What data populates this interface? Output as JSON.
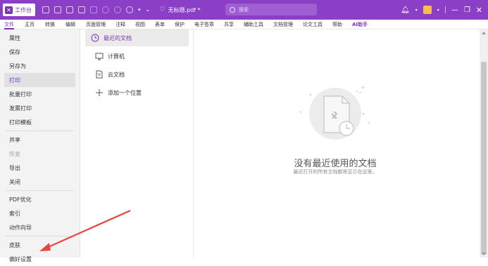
{
  "titlebar": {
    "workbench_label": "工作台",
    "doc_title": "无标题.pdf *",
    "search_placeholder": "搜索"
  },
  "menubar": {
    "items": [
      "文件",
      "主页",
      "转换",
      "编辑",
      "页面管理",
      "注释",
      "视图",
      "表单",
      "保护",
      "电子签章",
      "共享",
      "辅助工具",
      "文档管理",
      "论文工具",
      "帮助",
      "AI助手"
    ],
    "active_index": 0
  },
  "leftnav": {
    "items": [
      "属性",
      "保存",
      "另存为",
      "打印",
      "批量打印",
      "发票打印",
      "打印模板",
      "共享",
      "恢复",
      "导出",
      "关闭",
      "PDF优化",
      "索引",
      "动作向导",
      "皮肤",
      "偏好设置"
    ],
    "selected_index": 3,
    "disabled_index": 8
  },
  "locations": {
    "items": [
      {
        "label": "最近的文档",
        "icon": "clock-icon"
      },
      {
        "label": "计算机",
        "icon": "computer-icon"
      },
      {
        "label": "云文档",
        "icon": "cloud-document-icon"
      },
      {
        "label": "添加一个位置",
        "icon": "plus-icon"
      }
    ],
    "selected_index": 0
  },
  "empty_state": {
    "title": "没有最近使用的文档",
    "subtitle": "最近打开的所有文档都将显示在这里。"
  },
  "colors": {
    "brand": "#8b3fc7",
    "accent": "#7c32b8",
    "annotation": "#e8463c"
  }
}
